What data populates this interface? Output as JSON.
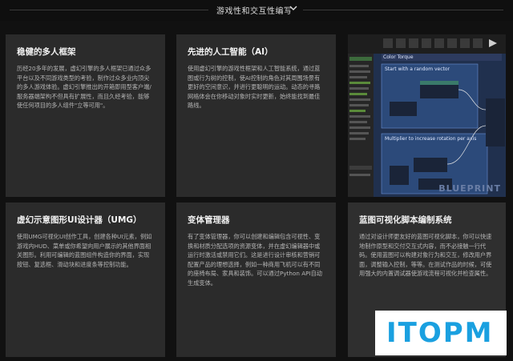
{
  "header": {
    "title": "游戏性和交互性编写",
    "expand_icon": "chevron-down-icon"
  },
  "cards": [
    {
      "title": "稳健的多人框架",
      "body": "历经20多年的发展，虚幻引擎的多人框架已通过众多平台以及不同游戏类型的考验，制作过众多业内顶尖的多人游戏体验。虚幻引擎推出的开箱即用型客户端/服务器端架构不但具有扩展性，而且久经考验，能够使任何项目的多人组件\"立等可用\"。"
    },
    {
      "title": "先进的人工智能（AI）",
      "body": "使用虚幻引擎的游戏性框架和人工智能系统，通过蓝图或行为树的控制，使AI控制的角色对其周围场景有更好的空间意识，并进行更聪明的运动。动态的寻路网格体会在你移动对象时实时更新，始终能找到最佳路线。"
    },
    {
      "title": "虚幻示意图形UI设计器（UMG）",
      "body": "使用UMG可视化UI创作工具，创建各种UI元素，例如游戏内HUD、菜单或你希望向用户展示的其他界面相关图形。利用可编辑的蓝图组件构造你的界面，实现按钮、复选框、滑动块和进度条等控制功能。"
    },
    {
      "title": "变体管理器",
      "body": "有了变体管理器，你可以创建和编辑包含可视性、变换和材质分配选项的资源变体，并在虚幻编辑器中或运行时激活或禁用它们。这是进行设计审核和营销可配置产品的理想选择，例如一种商用飞机可以有不同的座椅布局、家具和装饰。可以通过Python API自动生成变体。"
    },
    {
      "title": "蓝图可视化脚本编制系统",
      "body": "通过对设计师更友好的蓝图可视化脚本，你可以快速地制作原型和交付交互式内容，而不必接触一行代码。使用蓝图可以构建对象行为和交互，修改用户界面，调整输入控制，等等。在测试作品的时候，可使用强大的内置调试器使游戏流程可视化并检查属性。"
    }
  ],
  "screenshot": {
    "tab_label": "Color Torque",
    "node1_title": "Start with a random vector",
    "node2_title": "Multiplier to increase rotation per axis",
    "watermark": "BLUEPRINT"
  },
  "logo": {
    "text": "ITOPM"
  },
  "colors": {
    "background": "#111111",
    "card": "#2b2b2b",
    "logo_blue": "#1aa0e0"
  }
}
